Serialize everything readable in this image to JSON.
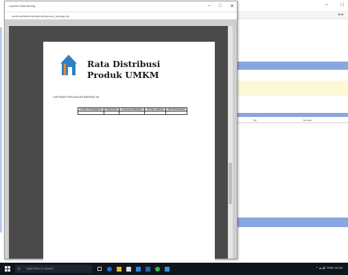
{
  "background_app": {
    "window_controls": [
      "–",
      "□"
    ],
    "nav_arrows": "◂ ▸",
    "table_headers": [
      "Tgl",
      "Jumlah"
    ],
    "colors": {
      "band": "#8aa6df",
      "highlight": "#fdf8d6"
    }
  },
  "preview_window": {
    "title": "Laporan Data Barang",
    "address": "localhost/distribusi/laporan/laporan_barang.php",
    "controls": [
      "–",
      "□",
      "✕"
    ]
  },
  "report": {
    "title_line1": "Rata Distribusi",
    "title_line2": "Produk UMKM",
    "subtitle": "LAPORAN PENJUALAN BARANG 08",
    "logo_icon": "house-logo-icon",
    "table_headers": [
      "KODE TRANSAKSI",
      "TANGGAL",
      "JUMLAH BARANG",
      "TOTAL HARGA",
      "KETERANGAN"
    ],
    "table_rows": [
      [
        "",
        "",
        "",
        "",
        ""
      ]
    ]
  },
  "taskbar": {
    "search_placeholder": "Type here to search",
    "tray_text": "^ ☁ 🔊 ENG 10:15",
    "app_icons": [
      "task-view-icon",
      "edge-icon",
      "explorer-icon",
      "store-icon",
      "mail-icon",
      "word-icon",
      "chrome-icon",
      "app-icon"
    ]
  }
}
